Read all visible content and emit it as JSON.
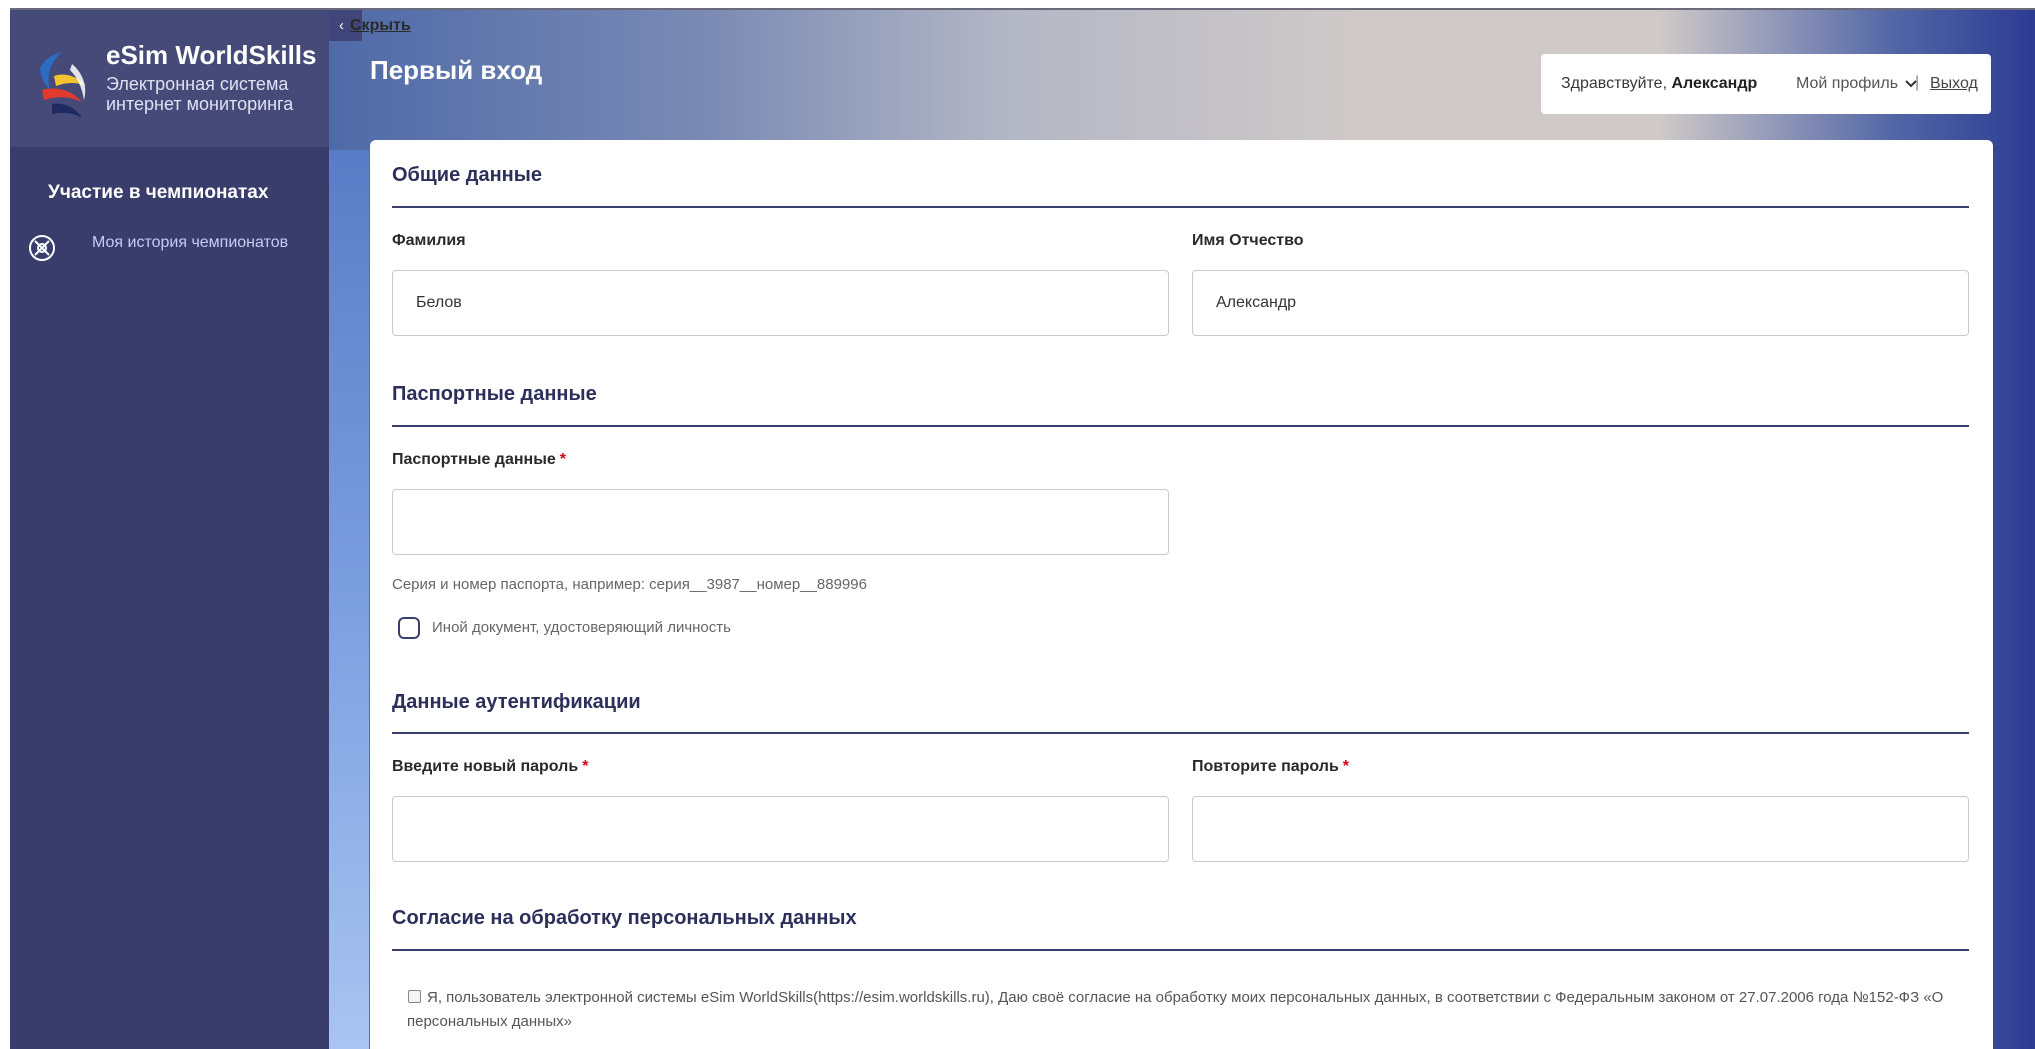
{
  "sidebar": {
    "app_name": "eSim WorldSkills",
    "app_subtitle": "Электронная система интернет мониторинга",
    "section_title": "Участие в чемпионатах",
    "nav_link": "Моя история чемпионатов"
  },
  "header": {
    "hide_label": "Скрыть",
    "page_title": "Первый вход",
    "greeting_prefix": "Здравствуйте,",
    "user_name": "Александр",
    "profile_label": "Мой профиль",
    "separator": "|",
    "logout_label": "Выход"
  },
  "form": {
    "general": {
      "heading": "Общие данные",
      "last_name_label": "Фамилия",
      "last_name_value": "Белов",
      "first_name_label": "Имя Отчество",
      "first_name_value": "Александр"
    },
    "passport": {
      "heading": "Паспортные данные",
      "field_label": "Паспортные данные",
      "required_mark": "*",
      "value": "",
      "hint": "Серия и номер паспорта, например: серия__3987__номер__889996",
      "other_doc_label": "Иной документ, удостоверяющий личность",
      "other_doc_checked": false
    },
    "auth": {
      "heading": "Данные аутентификации",
      "new_password_label": "Введите новый пароль",
      "repeat_password_label": "Повторите пароль",
      "required_mark": "*"
    },
    "consent": {
      "heading": "Согласие на обработку персональных данных",
      "text": "Я, пользователь электронной системы eSim WorldSkills(https://esim.worldskills.ru), Даю своё согласие на обработку моих персональных данных, в соответствии с Федеральным законом от 27.07.2006 года №152-ФЗ «О персональных данных»",
      "checked": false
    }
  },
  "colors": {
    "sidebar": "#383d6b",
    "sidebar_header": "#454a78",
    "heading": "#2c2f5a",
    "required": "#d0021b"
  }
}
